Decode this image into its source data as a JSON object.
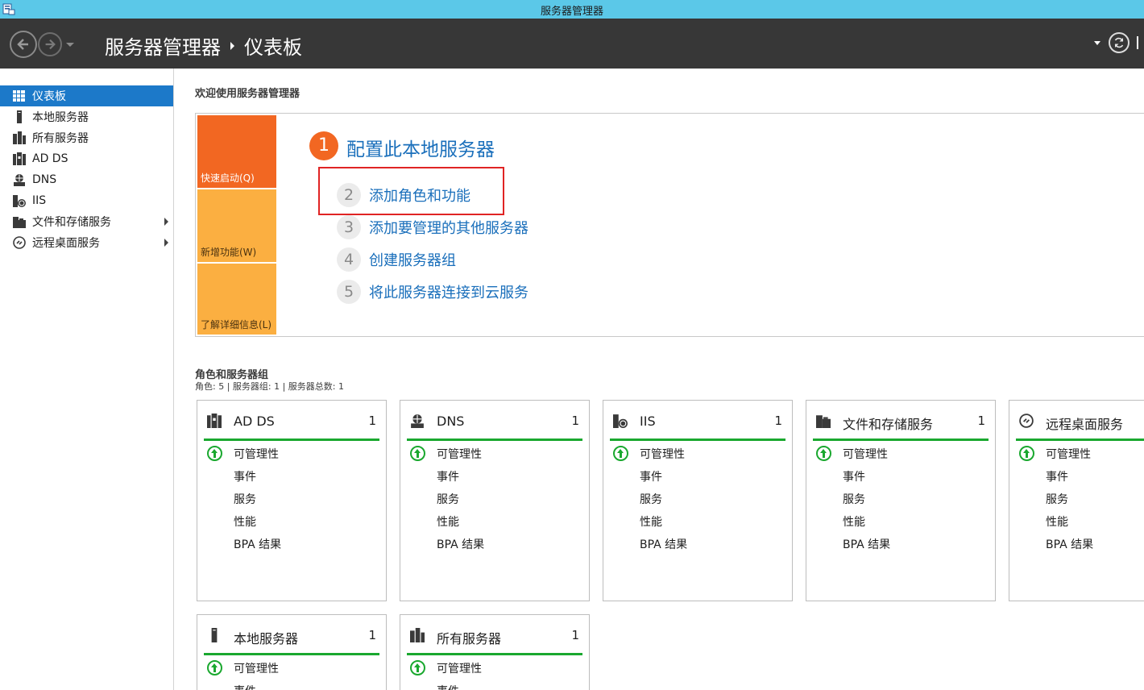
{
  "window": {
    "title": "服务器管理器"
  },
  "header": {
    "app_name": "服务器管理器",
    "page": "仪表板"
  },
  "sidebar": {
    "items": [
      {
        "label": "仪表板",
        "icon": "dashboard-icon",
        "active": true
      },
      {
        "label": "本地服务器",
        "icon": "local-server-icon"
      },
      {
        "label": "所有服务器",
        "icon": "all-servers-icon"
      },
      {
        "label": "AD DS",
        "icon": "adds-icon"
      },
      {
        "label": "DNS",
        "icon": "dns-icon"
      },
      {
        "label": "IIS",
        "icon": "iis-icon"
      },
      {
        "label": "文件和存储服务",
        "icon": "file-storage-icon",
        "expandable": true
      },
      {
        "label": "远程桌面服务",
        "icon": "remote-desktop-icon",
        "expandable": true
      }
    ]
  },
  "welcome": {
    "title": "欢迎使用服务器管理器",
    "tiles": {
      "quick": "快速启动(Q)",
      "new": "新增功能(W)",
      "learn": "了解详细信息(L)"
    },
    "steps": [
      {
        "num": "1",
        "text": "配置此本地服务器"
      },
      {
        "num": "2",
        "text": "添加角色和功能"
      },
      {
        "num": "3",
        "text": "添加要管理的其他服务器"
      },
      {
        "num": "4",
        "text": "创建服务器组"
      },
      {
        "num": "5",
        "text": "将此服务器连接到云服务"
      }
    ]
  },
  "roles": {
    "title": "角色和服务器组",
    "summary": "角色: 5 | 服务器组: 1 | 服务器总数: 1",
    "cards": [
      {
        "name": "AD DS",
        "count": "1",
        "lines": [
          "可管理性",
          "事件",
          "服务",
          "性能",
          "BPA 结果"
        ]
      },
      {
        "name": "DNS",
        "count": "1",
        "lines": [
          "可管理性",
          "事件",
          "服务",
          "性能",
          "BPA 结果"
        ]
      },
      {
        "name": "IIS",
        "count": "1",
        "lines": [
          "可管理性",
          "事件",
          "服务",
          "性能",
          "BPA 结果"
        ]
      },
      {
        "name": "文件和存储服务",
        "count": "1",
        "lines": [
          "可管理性",
          "事件",
          "服务",
          "性能",
          "BPA 结果"
        ]
      },
      {
        "name": "远程桌面服务",
        "count": "",
        "lines": [
          "可管理性",
          "事件",
          "服务",
          "性能",
          "BPA 结果"
        ]
      },
      {
        "name": "本地服务器",
        "count": "1",
        "lines": [
          "可管理性",
          "事件"
        ]
      },
      {
        "name": "所有服务器",
        "count": "1",
        "lines": [
          "可管理性",
          "事件"
        ]
      }
    ]
  },
  "colors": {
    "accent": "#1c79c9",
    "title_bar": "#5bc8e8",
    "header": "#373737",
    "quick_tile": "#f26722",
    "tile": "#fbaf41",
    "link": "#1a6fbb",
    "status_ok": "#1aa82f",
    "highlight": "#e02424"
  }
}
